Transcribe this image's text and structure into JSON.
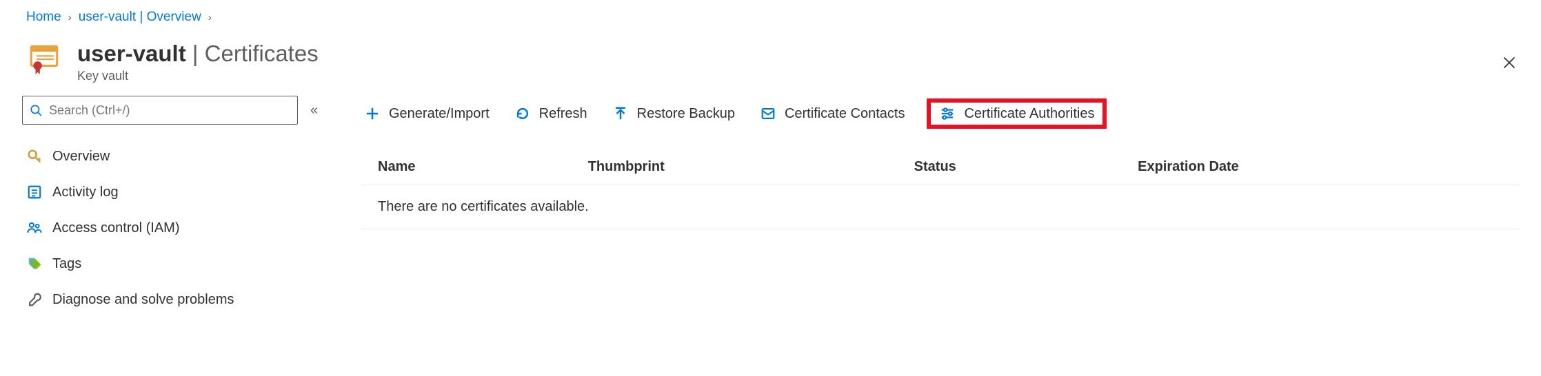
{
  "breadcrumb": {
    "home": "Home",
    "resource": "user-vault | Overview"
  },
  "header": {
    "title_strong": "user-vault",
    "title_sep": " | ",
    "title_rest": "Certificates",
    "subtitle": "Key vault"
  },
  "sidebar": {
    "search_placeholder": "Search (Ctrl+/)",
    "items": [
      {
        "label": "Overview"
      },
      {
        "label": "Activity log"
      },
      {
        "label": "Access control (IAM)"
      },
      {
        "label": "Tags"
      },
      {
        "label": "Diagnose and solve problems"
      }
    ]
  },
  "toolbar": {
    "generate": "Generate/Import",
    "refresh": "Refresh",
    "restore": "Restore Backup",
    "contacts": "Certificate Contacts",
    "authorities": "Certificate Authorities"
  },
  "table": {
    "columns": {
      "name": "Name",
      "thumbprint": "Thumbprint",
      "status": "Status",
      "expiration": "Expiration Date"
    },
    "empty_message": "There are no certificates available."
  }
}
